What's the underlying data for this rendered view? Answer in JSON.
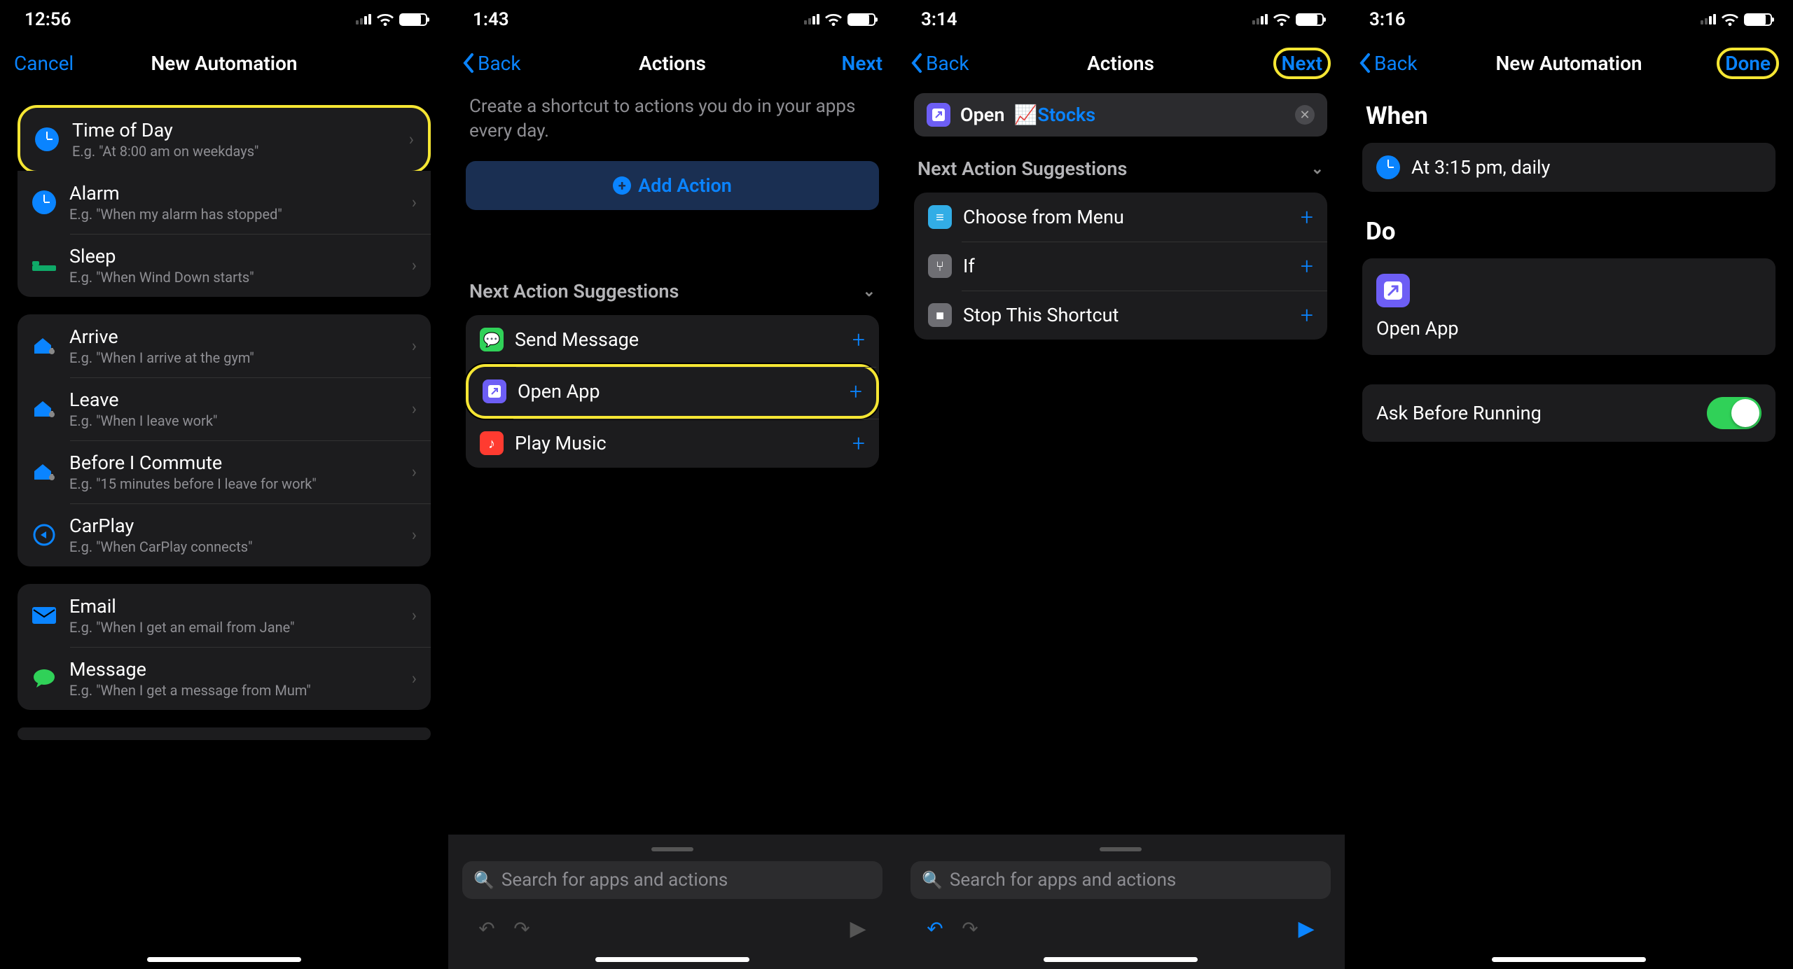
{
  "colors": {
    "accent": "#0a84ff",
    "highlight": "#f5e633",
    "green": "#30d158"
  },
  "screen1": {
    "time": "12:56",
    "nav": {
      "cancel": "Cancel",
      "title": "New Automation"
    },
    "groups": [
      {
        "items": [
          {
            "icon": "clock",
            "title": "Time of Day",
            "sub": "E.g. \"At 8:00 am on weekdays\"",
            "highlighted": true
          },
          {
            "icon": "alarm",
            "title": "Alarm",
            "sub": "E.g. \"When my alarm has stopped\""
          },
          {
            "icon": "bed",
            "title": "Sleep",
            "sub": "E.g. \"When Wind Down starts\""
          }
        ]
      },
      {
        "items": [
          {
            "icon": "arrive",
            "title": "Arrive",
            "sub": "E.g. \"When I arrive at the gym\""
          },
          {
            "icon": "leave",
            "title": "Leave",
            "sub": "E.g. \"When I leave work\""
          },
          {
            "icon": "commute",
            "title": "Before I Commute",
            "sub": "E.g. \"15 minutes before I leave for work\""
          },
          {
            "icon": "carplay",
            "title": "CarPlay",
            "sub": "E.g. \"When CarPlay connects\""
          }
        ]
      },
      {
        "items": [
          {
            "icon": "email",
            "title": "Email",
            "sub": "E.g. \"When I get an email from Jane\""
          },
          {
            "icon": "message",
            "title": "Message",
            "sub": "E.g. \"When I get a message from Mum\""
          }
        ]
      }
    ]
  },
  "screen2": {
    "time": "1:43",
    "nav": {
      "back": "Back",
      "title": "Actions",
      "next": "Next"
    },
    "description": "Create a shortcut to actions you do in your apps every day.",
    "add_action": "Add Action",
    "suggestions_header": "Next Action Suggestions",
    "suggestions": [
      {
        "icon": "green",
        "title": "Send Message"
      },
      {
        "icon": "purple",
        "title": "Open App",
        "highlighted": true
      },
      {
        "icon": "red",
        "title": "Play Music"
      }
    ],
    "search_placeholder": "Search for apps and actions"
  },
  "screen3": {
    "time": "3:14",
    "nav": {
      "back": "Back",
      "title": "Actions",
      "next": "Next"
    },
    "action": {
      "verb": "Open",
      "app": "Stocks",
      "app_emoji": "📈"
    },
    "suggestions_header": "Next Action Suggestions",
    "suggestions": [
      {
        "icon": "teal",
        "title": "Choose from Menu"
      },
      {
        "icon": "gray",
        "title": "If"
      },
      {
        "icon": "gray",
        "title": "Stop This Shortcut"
      }
    ],
    "search_placeholder": "Search for apps and actions"
  },
  "screen4": {
    "time": "3:16",
    "nav": {
      "back": "Back",
      "title": "New Automation",
      "done": "Done"
    },
    "when_label": "When",
    "when_text": "At 3:15 pm, daily",
    "do_label": "Do",
    "do_action": "Open App",
    "ask_label": "Ask Before Running"
  }
}
